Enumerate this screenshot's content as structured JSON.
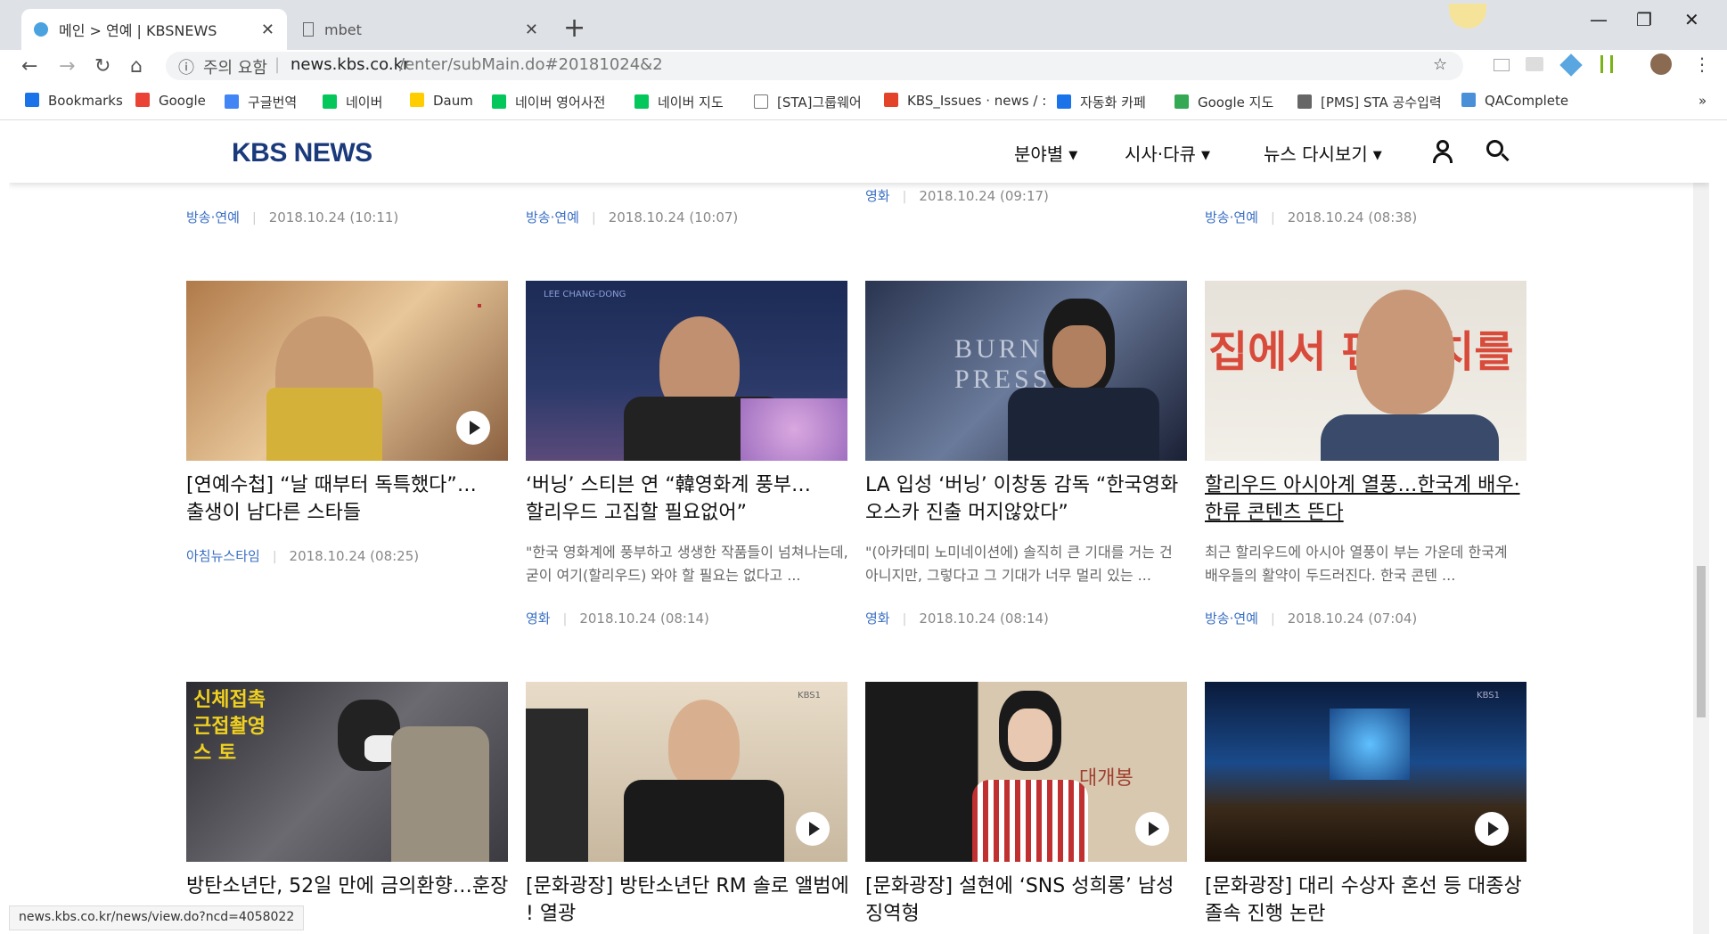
{
  "browser": {
    "tabs": [
      {
        "title": "메인 > 연예 | KBSNEWS"
      },
      {
        "title": "mbet"
      }
    ],
    "new_tab_symbol": "+",
    "close_symbol": "✕",
    "url_security": "주의 요함",
    "url_host": "news.kbs.co.kr",
    "url_path": "/enter/subMain.do#20181024&2",
    "status_url": "news.kbs.co.kr/news/view.do?ncd=4058022",
    "bookmarks": [
      {
        "label": "Bookmarks",
        "color": "#1a73e8"
      },
      {
        "label": "Google",
        "color": "#ea4335"
      },
      {
        "label": "구글번역",
        "color": "#4285f4"
      },
      {
        "label": "네이버",
        "color": "#03c75a"
      },
      {
        "label": "Daum",
        "color": "#ffcd00"
      },
      {
        "label": "네이버 영어사전",
        "color": "#03c75a"
      },
      {
        "label": "네이버 지도",
        "color": "#03c75a"
      },
      {
        "label": "[STA]그룹웨어",
        "color": "#777777"
      },
      {
        "label": "KBS_Issues · news / :",
        "color": "#e24329"
      },
      {
        "label": "자동화 카페",
        "color": "#1a73e8"
      },
      {
        "label": "Google 지도",
        "color": "#34a853"
      },
      {
        "label": "[PMS] STA 공수입력",
        "color": "#666666"
      },
      {
        "label": "QAComplete",
        "color": "#4a90d9"
      }
    ],
    "bookmarks_more": "»"
  },
  "site": {
    "logo": "KBS NEWS",
    "menu": [
      "분야별",
      "시사·다큐",
      "뉴스 다시보기"
    ]
  },
  "top_row_meta": [
    {
      "category": "방송·연예",
      "date": "2018.10.24 (10:11)"
    },
    {
      "category": "방송·연예",
      "date": "2018.10.24 (10:07)"
    },
    {
      "category": "영화",
      "date": "2018.10.24 (09:17)"
    },
    {
      "category": "방송·연예",
      "date": "2018.10.24 (08:38)"
    }
  ],
  "articles_row1": [
    {
      "headline1": "[연예수첩] “날 때부터 독특했다”…",
      "headline2": "출생이 남다른 스타들",
      "summary1": "",
      "summary2": "",
      "category": "아침뉴스타임",
      "date": "2018.10.24 (08:25)",
      "thumb_overlay": ""
    },
    {
      "headline1": "‘버닝’ 스티븐 연 “韓영화계 풍부…",
      "headline2": "할리우드 고집할 필요없어”",
      "summary1": "\"한국 영화계에 풍부하고 생생한 작품들이 넘쳐나는데,",
      "summary2": "굳이 여기(할리우드) 와야 할 필요는 없다고 ...",
      "category": "영화",
      "date": "2018.10.24 (08:14)",
      "thumb_overlay": "LEE CHANG-DONG"
    },
    {
      "headline1": "LA 입성 ‘버닝’ 이창동 감독 “한국영화",
      "headline2": "오스카 진출 머지않았다”",
      "summary1": "\"(아카데미 노미네이션에) 솔직히 큰 기대를 거는 건",
      "summary2": "아니지만, 그렇다고 그 기대가 너무 멀리 있는 ...",
      "category": "영화",
      "date": "2018.10.24 (08:14)",
      "thumb_overlay": "BURNING PRESS"
    },
    {
      "headline1": "할리우드 아시아계 열풍…한국계 배우·",
      "headline2": "한류 콘텐츠 뜬다",
      "summary1": "최근 할리우드에 아시아 열풍이 부는 가운데 한국계",
      "summary2": "배우들의 활약이 두드러진다. 한국 콘텐 ...",
      "category": "방송·연예",
      "date": "2018.10.24 (07:04)",
      "thumb_overlay": "집에서 편 서치를"
    }
  ],
  "articles_row2": [
    {
      "headline1": "방탄소년단, 52일 만에 금의환향…훈장",
      "headline2": "",
      "thumb_overlay": "신체접촉 근접촬영 스 토"
    },
    {
      "headline1": "[문화광장] 방탄소년단 RM 솔로 앨범에",
      "headline2": "! 열광",
      "thumb_overlay": "KBS1"
    },
    {
      "headline1": "[문화광장] 설현에 ‘SNS 성희롱’ 남성",
      "headline2": "징역형",
      "thumb_overlay": "대개봉"
    },
    {
      "headline1": "[문화광장] 대리 수상자 혼선 등 대종상",
      "headline2": "졸속 진행 논란",
      "thumb_overlay": "KBS1"
    }
  ]
}
